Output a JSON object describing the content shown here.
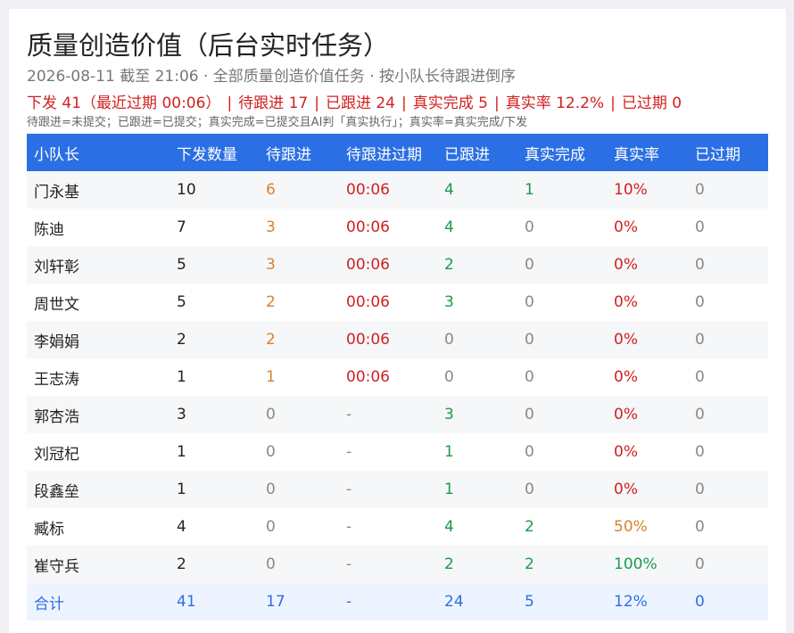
{
  "header": {
    "title": "质量创造价值（后台实时任务）",
    "subtitle": "2026-08-11 截至 21:06 · 全部质量创造价值任务 · 按小队长待跟进倒序"
  },
  "summary": {
    "issued": "下发 41（最近过期 00:06）",
    "pending": "待跟进 17",
    "followed": "已跟进 24",
    "real_done": "真实完成 5",
    "real_rate": "真实率 12.2%",
    "expired": "已过期 0",
    "separator": "|"
  },
  "note": "待跟进=未提交；已跟进=已提交；真实完成=已提交且AI判「真实执行」；真实率=真实完成/下发",
  "table": {
    "columns": [
      "小队长",
      "下发数量",
      "待跟进",
      "待跟进过期",
      "已跟进",
      "真实完成",
      "真实率",
      "已过期"
    ],
    "rows": [
      [
        "门永基",
        "10",
        "6",
        "00:06",
        "4",
        "1",
        "10%",
        "0"
      ],
      [
        "陈迪",
        "7",
        "3",
        "00:06",
        "4",
        "0",
        "0%",
        "0"
      ],
      [
        "刘轩彰",
        "5",
        "3",
        "00:06",
        "2",
        "0",
        "0%",
        "0"
      ],
      [
        "周世文",
        "5",
        "2",
        "00:06",
        "3",
        "0",
        "0%",
        "0"
      ],
      [
        "李娟娟",
        "2",
        "2",
        "00:06",
        "0",
        "0",
        "0%",
        "0"
      ],
      [
        "王志涛",
        "1",
        "1",
        "00:06",
        "0",
        "0",
        "0%",
        "0"
      ],
      [
        "郭杏浩",
        "3",
        "0",
        "-",
        "3",
        "0",
        "0%",
        "0"
      ],
      [
        "刘冠杞",
        "1",
        "0",
        "-",
        "1",
        "0",
        "0%",
        "0"
      ],
      [
        "段鑫垒",
        "1",
        "0",
        "-",
        "1",
        "0",
        "0%",
        "0"
      ],
      [
        "臧标",
        "4",
        "0",
        "-",
        "4",
        "2",
        "50%",
        "0"
      ],
      [
        "崔守兵",
        "2",
        "0",
        "-",
        "2",
        "2",
        "100%",
        "0"
      ]
    ],
    "total": [
      "合计",
      "41",
      "17",
      "-",
      "24",
      "5",
      "12%",
      "0"
    ]
  },
  "colors": {
    "header_bg": "#2b6fe5",
    "alert_red": "#d32020",
    "pending_orange": "#d9822b",
    "success_green": "#1a9a4a"
  }
}
